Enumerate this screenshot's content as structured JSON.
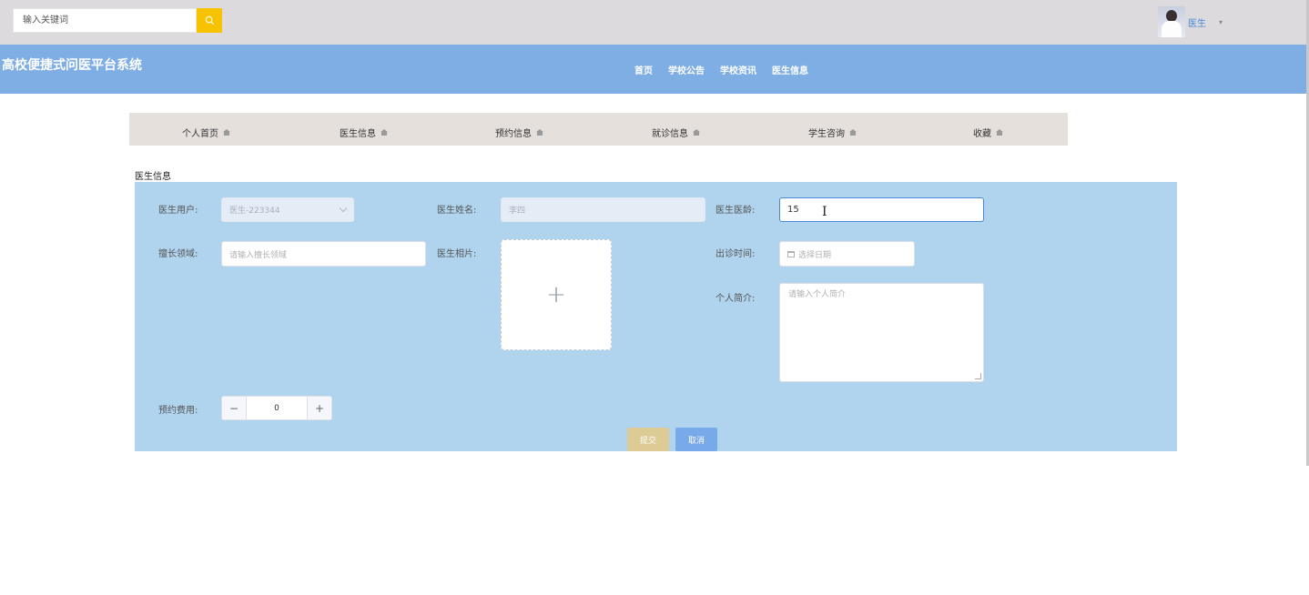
{
  "header": {
    "search_placeholder": "输入关键词",
    "user_name": "医生",
    "user_caret": "▾"
  },
  "navbar": {
    "title": "高校便捷式问医平台系统",
    "links": [
      "首页",
      "学校公告",
      "学校资讯",
      "医生信息"
    ]
  },
  "tabs": [
    "个人首页",
    "医生信息",
    "预约信息",
    "就诊信息",
    "学生咨询",
    "收藏"
  ],
  "section_title": "医生信息",
  "form": {
    "doctor_user_label": "医生用户:",
    "doctor_user_value": "医生-223344",
    "doctor_name_label": "医生姓名:",
    "doctor_name_value": "李四",
    "doctor_age_label": "医生医龄:",
    "doctor_age_value": "15",
    "specialty_label": "擅长领域:",
    "specialty_placeholder": "请输入擅长领域",
    "photo_label": "医生相片:",
    "photo_plus": "+",
    "clinic_time_label": "出诊时间:",
    "clinic_time_placeholder": "选择日期",
    "intro_label": "个人简介:",
    "intro_placeholder": "请输入个人简介",
    "fee_label": "预约费用:",
    "fee_value": "0",
    "minus": "−",
    "plus": "+",
    "submit_label": "提交",
    "cancel_label": "取消"
  },
  "colors": {
    "topbar": "#dcdadd",
    "navbar": "#7eaee3",
    "form_panel": "#b0d3ee",
    "search_button": "#f7c300",
    "submit_button": "#dccb95",
    "cancel_button": "#78a9e8"
  }
}
